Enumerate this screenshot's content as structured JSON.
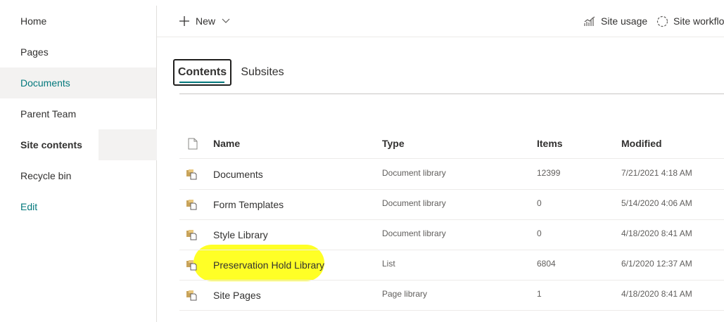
{
  "nav": {
    "items": [
      {
        "label": "Home"
      },
      {
        "label": "Pages"
      },
      {
        "label": "Documents"
      },
      {
        "label": "Parent Team"
      },
      {
        "label": "Site contents"
      },
      {
        "label": "Recycle bin"
      },
      {
        "label": "Edit"
      }
    ]
  },
  "command_bar": {
    "new_label": "New",
    "site_usage_label": "Site usage",
    "site_workflows_label": "Site workflo"
  },
  "tabs": [
    {
      "label": "Contents",
      "active": true
    },
    {
      "label": "Subsites",
      "active": false
    }
  ],
  "table": {
    "columns": [
      "Name",
      "Type",
      "Items",
      "Modified"
    ],
    "rows": [
      {
        "name": "Documents",
        "type": "Document library",
        "items": "12399",
        "modified": "7/21/2021 4:18 AM"
      },
      {
        "name": "Form Templates",
        "type": "Document library",
        "items": "0",
        "modified": "5/14/2020 4:06 AM"
      },
      {
        "name": "Style Library",
        "type": "Document library",
        "items": "0",
        "modified": "4/18/2020 8:41 AM"
      },
      {
        "name": "Preservation Hold Library",
        "type": "List",
        "items": "6804",
        "modified": "6/1/2020 12:37 AM"
      },
      {
        "name": "Site Pages",
        "type": "Page library",
        "items": "1",
        "modified": "4/18/2020 8:41 AM"
      }
    ]
  },
  "colors": {
    "accent": "#03787c",
    "highlight": "#ffff00",
    "selected_nav_bg": "#f3f2f1"
  },
  "icons": {
    "new": "plus-icon",
    "new_menu": "chevron-down-icon",
    "site_usage": "chart-icon",
    "site_workflows": "workflow-icon",
    "file_type_header": "document-icon",
    "library": "library-icon"
  }
}
